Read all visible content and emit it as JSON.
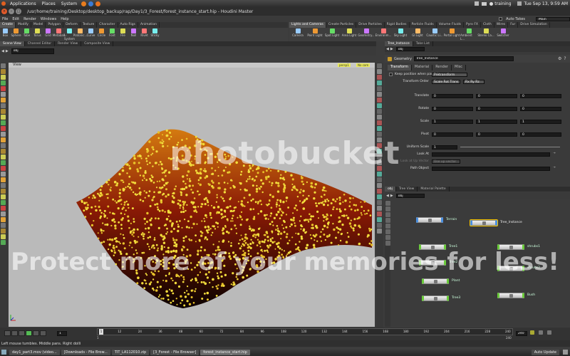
{
  "ubuntu_bar": {
    "menus": [
      "Applications",
      "Places",
      "System"
    ],
    "user": "training",
    "clock": "Tue Sep 13,  9:59 AM"
  },
  "title": "/usr/home/training/Desktop/desktop_backup/rap/Day1/3_Forest/forest_instance_start.hip - Houdini Master",
  "menu": [
    "File",
    "Edit",
    "Render",
    "Windows",
    "Help"
  ],
  "desktop": {
    "auto_takes": "Auto Takes",
    "desktop_name": "Main"
  },
  "shelf_left": {
    "tabs": [
      "Create",
      "Modify",
      "Model",
      "Polygon",
      "Deform",
      "Texture",
      "Character",
      "Auto Rigs",
      "Animation"
    ],
    "tools": [
      "Box",
      "Sphere",
      "Tube",
      "Torus",
      "Grid",
      "Metaball",
      "L-System",
      "Platonic...",
      "Curve",
      "Circle",
      "Font",
      "File",
      "Null",
      "Rivet",
      "Sticky"
    ]
  },
  "shelf_right": {
    "tabs": [
      "Lights and Cameras",
      "Create Particles",
      "Drive Particles",
      "Rigid Bodies",
      "Particle Fluids",
      "Volume Fluids",
      "Pyro FX",
      "Cloth",
      "Wires",
      "Fur",
      "Drive Simulation"
    ],
    "tools": [
      "Camera",
      "Point Light",
      "Spot Light",
      "Area Light",
      "Geometry...",
      "Environm...",
      "Sky Light",
      "GI Light",
      "Caustic Li...",
      "Portal Light",
      "Ambient L...",
      "Stereo Ca...",
      "Switcher"
    ]
  },
  "left_tabs": [
    "Scene View",
    "Channel Editor",
    "Render View",
    "Composite View"
  ],
  "right_tabs": [
    "Tree_Instance",
    "Take List"
  ],
  "viewport": {
    "path": "obj",
    "view_label": "View",
    "cam_label": "persp1",
    "cam2_label": "No cam"
  },
  "status": "Left mouse tumbles.  Middle pans.  Right dolli",
  "params": {
    "type_label": "Geometry",
    "node_name": "Tree_Instance",
    "tabs": [
      "Transform",
      "Material",
      "Render",
      "Misc"
    ],
    "keep_pos": "Keep position when parenting",
    "pretransform": "Pretransform",
    "xform_order_label": "Transform Order",
    "xform_order": "Scale Rot Trans",
    "rot_order": "Rx Ry Rz",
    "rows": [
      {
        "label": "Translate",
        "vals": [
          "0",
          "0",
          "0"
        ]
      },
      {
        "label": "Rotate",
        "vals": [
          "0",
          "0",
          "0"
        ]
      },
      {
        "label": "Scale",
        "vals": [
          "1",
          "1",
          "1"
        ]
      },
      {
        "label": "Pivot",
        "vals": [
          "0",
          "0",
          "0"
        ]
      }
    ],
    "uniform_label": "Uniform Scale",
    "uniform": "1",
    "lookat_label": "Look At",
    "upvec_label": "Look at Up Vector",
    "upvec": "Use up vector",
    "path_label": "Path Object"
  },
  "network": {
    "tabs": [
      "obj",
      "Tree View",
      "Material Palette"
    ],
    "path": "obj",
    "nodes": [
      "Terrain",
      "Tree_Instance",
      "Tree1",
      "Tree2",
      "Tree3",
      "shrubs1",
      "shrubs2",
      "Bush",
      "Plant"
    ]
  },
  "timeline": {
    "frame": "1",
    "ticks": [
      "1",
      "12",
      "24",
      "36",
      "48",
      "60",
      "72",
      "84",
      "96",
      "108",
      "120",
      "132",
      "144",
      "156",
      "168",
      "180",
      "192",
      "204",
      "216",
      "228",
      "240"
    ],
    "start": "1",
    "end": "240",
    "end2": "240",
    "fstep": "1"
  },
  "taskbar": [
    "day1_part3.mov (video...",
    "[Downloads - File Brow...",
    "TIT_LA112010.zip",
    "[3_Forest - File Browser]",
    "forest_instance_start.hip",
    "Auto Update"
  ],
  "watermark": {
    "title": "photobucket",
    "tagline": "Protect more of your memories for less!"
  }
}
